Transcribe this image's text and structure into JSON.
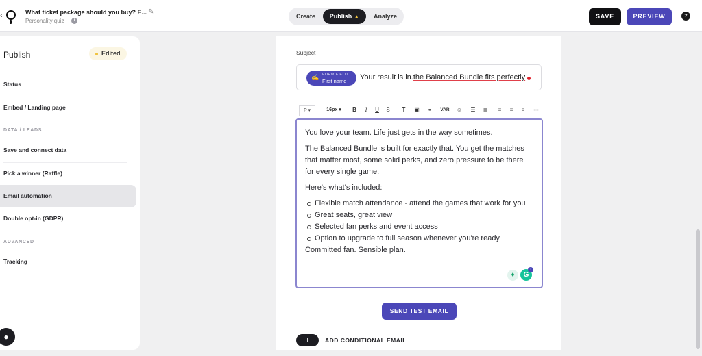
{
  "header": {
    "back_icon": "chevron-left-icon",
    "quiz_title": "What ticket package should you buy? E...",
    "quiz_type": "Personality quiz",
    "info_glyph": "i",
    "tabs": [
      {
        "label": "Create"
      },
      {
        "label": "Publish",
        "warning_icon": "warning-icon"
      },
      {
        "label": "Analyze"
      }
    ],
    "save_label": "SAVE",
    "preview_label": "PREVIEW",
    "chat_glyph": "?"
  },
  "sidebar": {
    "title": "Publish",
    "badge": "Edited",
    "items": {
      "status": "Status",
      "embed": "Embed / Landing page",
      "save_data": "Save and connect data",
      "raffle": "Pick a winner (Raffle)",
      "email_automation": "Email automation",
      "double_optin": "Double opt-in (GDPR)",
      "tracking": "Tracking"
    },
    "sections": {
      "data_leads": "DATA / LEADS",
      "advanced": "ADVANCED"
    }
  },
  "email": {
    "subject_label": "Subject",
    "chip_small": "FORM FIELD",
    "chip_name": "First name",
    "subject_prefix": "Your result is in.",
    "subject_suffix": "the Balanced Bundle fits perfectly",
    "toolbar": {
      "paragraph": "P",
      "font_size": "16px",
      "bold": "B",
      "italic": "I",
      "underline": "U",
      "strike": "S",
      "var": "VAR"
    },
    "body": {
      "p1": "You love your team. Life just gets in the way sometimes.",
      "p2": "The Balanced Bundle is built for exactly that. You get the matches that matter most, some solid perks, and zero pressure to be there for every single game.",
      "p3": "Here's what's included:",
      "list": [
        "Flexible match attendance - attend the games that work for you",
        "Great seats, great view",
        "Selected fan perks and event access",
        "Option to upgrade to full season whenever you're ready"
      ],
      "p4": "Committed fan. Sensible plan."
    },
    "grammarly_count": "1",
    "grammarly_glyph": "G",
    "send_test_label": "SEND TEST EMAIL",
    "add_conditional_label": "ADD CONDITIONAL EMAIL",
    "add_glyph": "+"
  }
}
